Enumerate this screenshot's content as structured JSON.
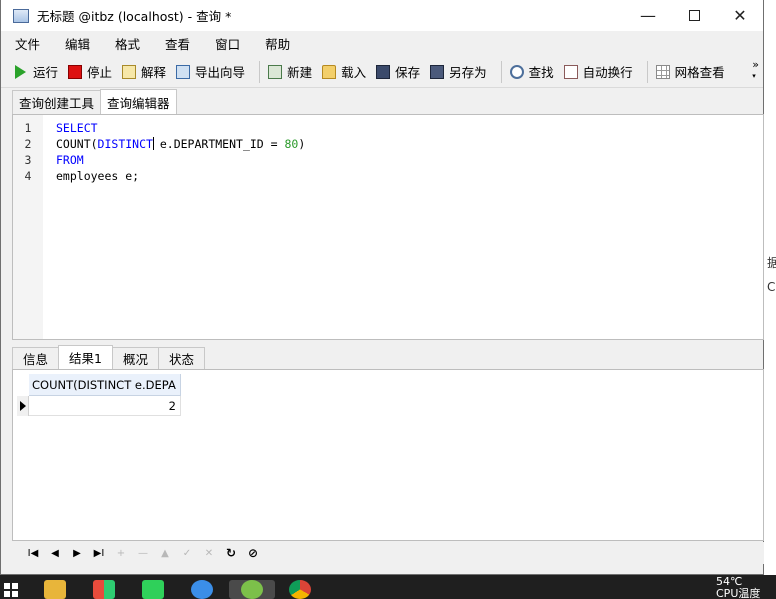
{
  "window": {
    "title": "无标题 @itbz (localhost) - 查询 *",
    "minimize": "—",
    "close": "✕"
  },
  "menu": [
    "文件",
    "编辑",
    "格式",
    "查看",
    "窗口",
    "帮助"
  ],
  "toolbar": {
    "run": "运行",
    "stop": "停止",
    "explain": "解释",
    "export_wizard": "导出向导",
    "new": "新建",
    "load": "载入",
    "save": "保存",
    "save_as": "另存为",
    "find": "查找",
    "word_wrap": "自动换行",
    "grid_view": "网格查看",
    "more": "»"
  },
  "query_tabs": [
    "查询创建工具",
    "查询编辑器"
  ],
  "editor": {
    "line_numbers": [
      "1",
      "2",
      "3",
      "4"
    ],
    "line1": "SELECT",
    "line2_a": "COUNT(",
    "line2_kw": "DISTINCT",
    "line2_b": " e.DEPARTMENT_ID = ",
    "line2_num": "80",
    "line2_c": ")",
    "line3": "FROM",
    "line4": "employees e;"
  },
  "result_tabs": [
    "信息",
    "结果1",
    "概况",
    "状态"
  ],
  "result_grid": {
    "columns": [
      "COUNT(DISTINCT e.DEPA"
    ],
    "rows": [
      [
        "2"
      ]
    ]
  },
  "nav": {
    "first": "I◀",
    "prev": "◀",
    "next": "▶",
    "last": "▶I",
    "add": "+",
    "delete": "—",
    "edit": "▲",
    "apply": "✓",
    "cancel": "✕",
    "refresh": "↻",
    "stop": "⊘"
  },
  "background_fragments": [
    "据",
    "Co"
  ],
  "taskbar": {
    "temp": "54℃",
    "cpu_label": "CPU温度"
  },
  "colors": {
    "keyword": "#0000ff",
    "number": "#2a9a2a",
    "header_bg": "#eaf1fb"
  }
}
